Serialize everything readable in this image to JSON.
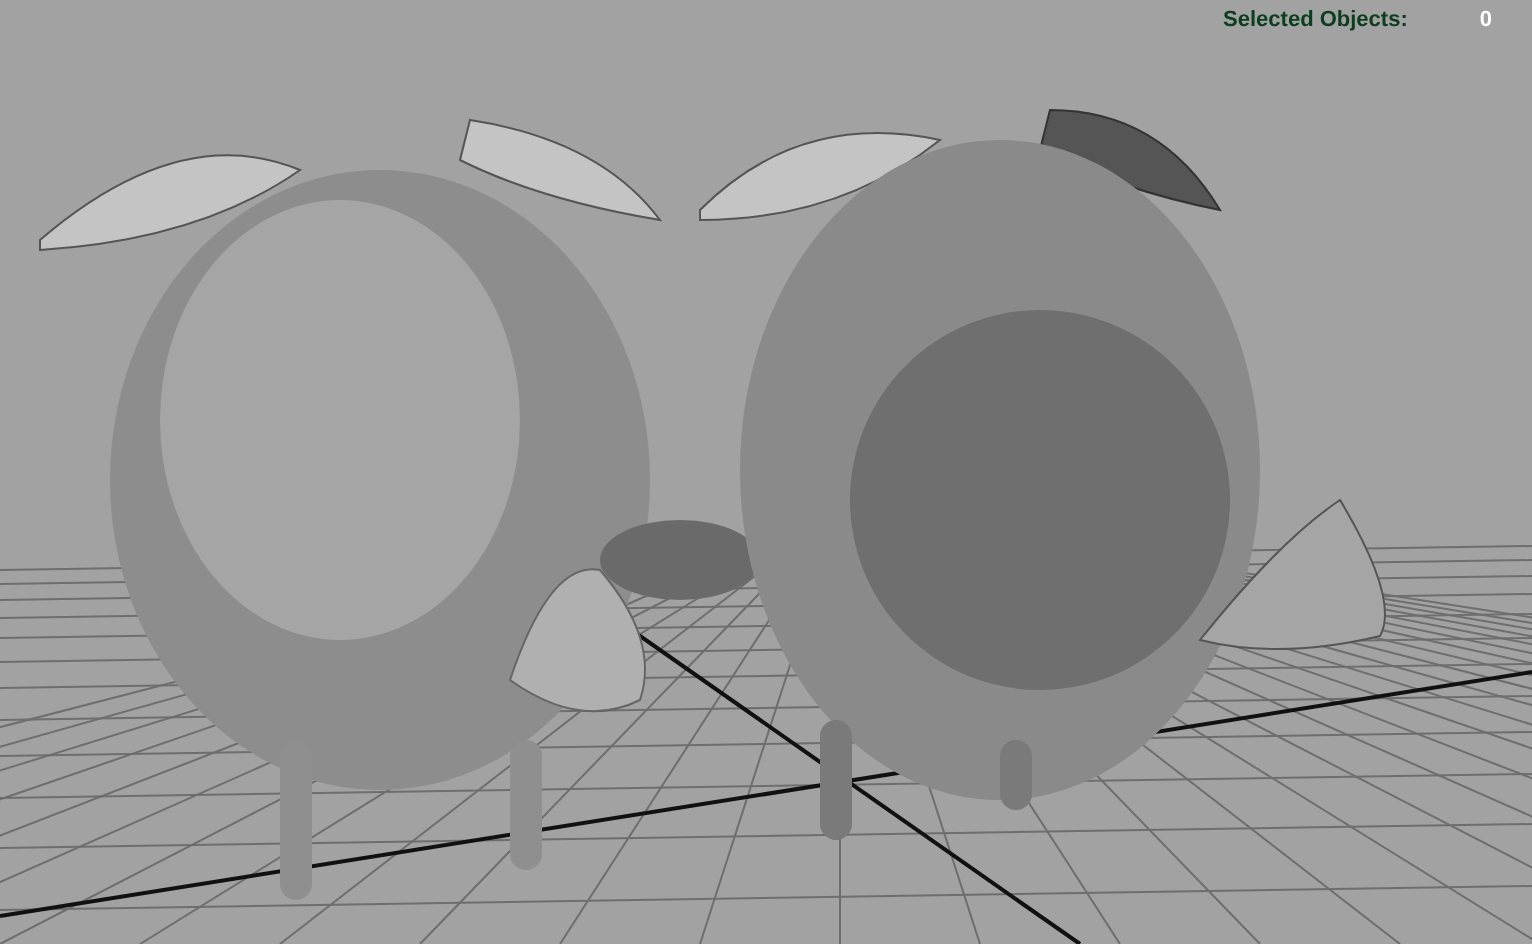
{
  "hud": {
    "label": "Selected Objects:",
    "value": "0"
  }
}
